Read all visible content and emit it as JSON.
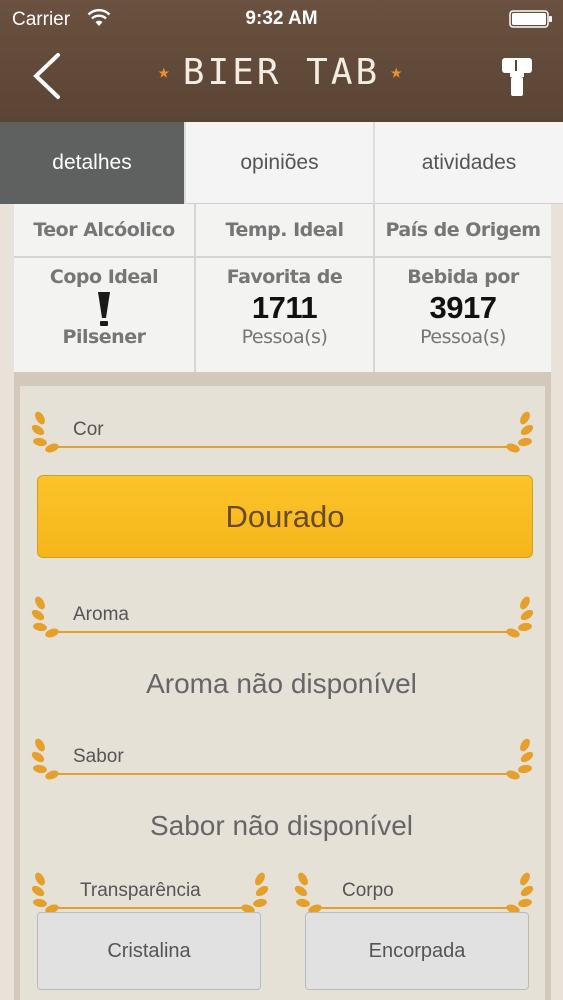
{
  "status": {
    "carrier": "Carrier",
    "time": "9:32 AM"
  },
  "header": {
    "title": "BIER TAB"
  },
  "tabs": [
    {
      "label": "detalhes",
      "active": true
    },
    {
      "label": "opiniões",
      "active": false
    },
    {
      "label": "atividades",
      "active": false
    }
  ],
  "info": {
    "teor": "Teor Alcóolico",
    "temp": "Temp. Ideal",
    "pais": "País de Origem",
    "copo_label": "Copo Ideal",
    "copo_value": "Pilsener",
    "favorita_label": "Favorita de",
    "favorita_count": "1711",
    "favorita_unit": "Pessoa(s)",
    "bebida_label": "Bebida por",
    "bebida_count": "3917",
    "bebida_unit": "Pessoa(s)"
  },
  "sections": {
    "cor_label": "Cor",
    "cor_value": "Dourado",
    "aroma_label": "Aroma",
    "aroma_value": "Aroma não disponível",
    "sabor_label": "Sabor",
    "sabor_value": "Sabor não disponível",
    "transparencia_label": "Transparência",
    "transparencia_value": "Cristalina",
    "corpo_label": "Corpo",
    "corpo_value": "Encorpada"
  },
  "colors": {
    "accent": "#e5a02c",
    "header": "#5a4434",
    "cor_swatch": "#fbbf24"
  }
}
